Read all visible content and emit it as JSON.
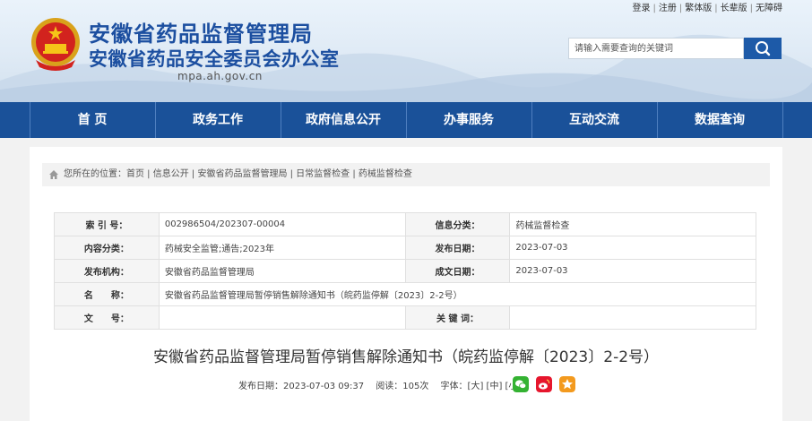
{
  "header": {
    "title": "安徽省药品监督管理局",
    "subtitle": "安徽省药品安全委员会办公室",
    "domain": "mpa.ah.gov.cn"
  },
  "toplinks": [
    "登录",
    "注册",
    "繁体版",
    "长辈版",
    "无障碍"
  ],
  "search": {
    "placeholder": "请输入需要查询的关键词"
  },
  "nav": {
    "items": [
      {
        "label": "首  页"
      },
      {
        "label": "政务工作"
      },
      {
        "label": "政府信息公开"
      },
      {
        "label": "办事服务"
      },
      {
        "label": "互动交流"
      },
      {
        "label": "数据查询"
      }
    ]
  },
  "breadcrumb": "您所在的位置：首页 | 信息公开 | 安徽省药品监督管理局 | 日常监督检查 | 药械监督检查",
  "meta": {
    "rows": [
      {
        "l1": "索 引 号：",
        "v1": "002986504/202307-00004",
        "l2": "信息分类：",
        "v2": "药械监督检查"
      },
      {
        "l1": "内容分类：",
        "v1": "药械安全监管;通告;2023年",
        "l2": "发布日期：",
        "v2": "2023-07-03"
      },
      {
        "l1": "发布机构：",
        "v1": "安徽省药品监督管理局",
        "l2": "成文日期：",
        "v2": "2023-07-03"
      }
    ],
    "name_label": "名　　称：",
    "name_value": "安徽省药品监督管理局暂停销售解除通知书（皖药监停解〔2023〕2-2号）",
    "doc_label": "文　　号：",
    "doc_value": "",
    "kw_label": "关 键 词：",
    "kw_value": ""
  },
  "article": {
    "title": "安徽省药品监督管理局暂停销售解除通知书（皖药监停解〔2023〕2-2号）",
    "info": "发布日期：2023-07-03 09:37 　阅读：105次 　字体：[大] [中] [小]"
  },
  "colors": {
    "nav": "#1a5199",
    "title_blue": "#1c4fa0",
    "wechat": "#34b232",
    "weibo": "#e6162d",
    "favorite": "#f39a1e"
  },
  "share_icons": [
    "wechat-icon",
    "weibo-icon",
    "favorite-icon"
  ]
}
